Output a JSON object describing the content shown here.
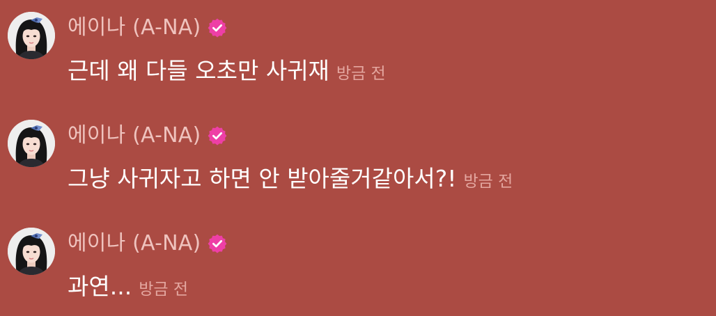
{
  "messages": [
    {
      "sender": "에이나 (A-NA)",
      "text": "근데 왜 다들 오초만 사귀재",
      "time": "방금 전"
    },
    {
      "sender": "에이나 (A-NA)",
      "text": "그냥 사귀자고 하면 안 받아줄거같아서?!",
      "time": "방금 전"
    },
    {
      "sender": "에이나 (A-NA)",
      "text": "과연...",
      "time": "방금 전"
    }
  ],
  "icons": {
    "verified": "verified-badge-icon",
    "avatar": "profile-avatar"
  },
  "colors": {
    "background": "#ab4b43",
    "sender_name": "#efc3be",
    "message_text": "#ffffff",
    "timestamp": "#e4a7a0",
    "verified_badge": "#ee3fa6"
  }
}
